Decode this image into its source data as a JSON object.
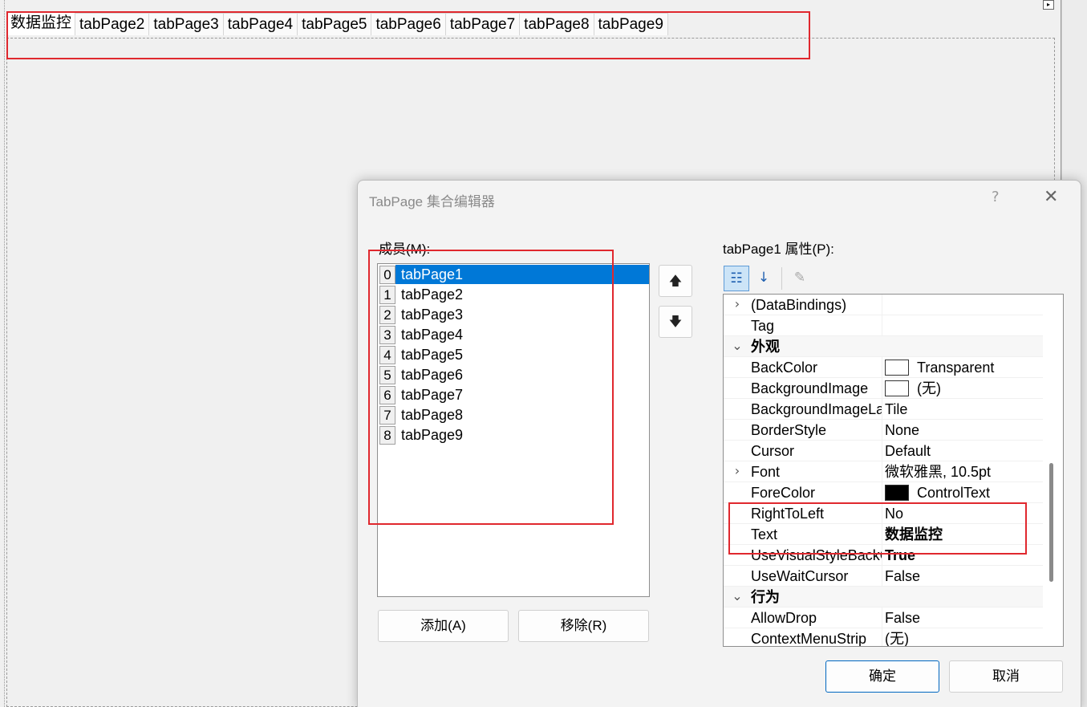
{
  "designer": {
    "tabs": [
      "数据监控",
      "tabPage2",
      "tabPage3",
      "tabPage4",
      "tabPage5",
      "tabPage6",
      "tabPage7",
      "tabPage8",
      "tabPage9"
    ],
    "smart_tag_glyph": "▸"
  },
  "dialog": {
    "title": "TabPage 集合编辑器",
    "help": "?",
    "close": "✕",
    "members_label": "成员(M):",
    "members": [
      {
        "index": "0",
        "name": "tabPage1",
        "selected": true
      },
      {
        "index": "1",
        "name": "tabPage2"
      },
      {
        "index": "2",
        "name": "tabPage3"
      },
      {
        "index": "3",
        "name": "tabPage4"
      },
      {
        "index": "4",
        "name": "tabPage5"
      },
      {
        "index": "5",
        "name": "tabPage6"
      },
      {
        "index": "6",
        "name": "tabPage7"
      },
      {
        "index": "7",
        "name": "tabPage8"
      },
      {
        "index": "8",
        "name": "tabPage9"
      }
    ],
    "move_up": "🡅",
    "move_down": "🡇",
    "add_label": "添加(A)",
    "remove_label": "移除(R)",
    "props_label": "tabPage1 属性(P):",
    "ok_label": "确定",
    "cancel_label": "取消",
    "toolbar": {
      "categorized_icon": "categorized-icon",
      "alphabetical_icon": "alphabetical-icon",
      "property_pages_icon": "wrench-icon"
    },
    "properties": [
      {
        "expander": "›",
        "name": "(DataBindings)",
        "value": ""
      },
      {
        "expander": "",
        "name": "Tag",
        "value": ""
      },
      {
        "expander": "⌄",
        "name": "外观",
        "value": "",
        "category": true
      },
      {
        "expander": "",
        "name": "BackColor",
        "value": "Transparent",
        "swatch": "white"
      },
      {
        "expander": "",
        "name": "BackgroundImage",
        "value": "(无)",
        "swatch": "white"
      },
      {
        "expander": "",
        "name": "BackgroundImageLayout",
        "value": "Tile"
      },
      {
        "expander": "",
        "name": "BorderStyle",
        "value": "None"
      },
      {
        "expander": "",
        "name": "Cursor",
        "value": "Default"
      },
      {
        "expander": "›",
        "name": "Font",
        "value": "微软雅黑, 10.5pt"
      },
      {
        "expander": "",
        "name": "ForeColor",
        "value": "ControlText",
        "swatch": "black"
      },
      {
        "expander": "",
        "name": "RightToLeft",
        "value": "No"
      },
      {
        "expander": "",
        "name": "Text",
        "value": "数据监控",
        "bold": true
      },
      {
        "expander": "",
        "name": "UseVisualStyleBackColor",
        "value": "True",
        "bold": true
      },
      {
        "expander": "",
        "name": "UseWaitCursor",
        "value": "False"
      },
      {
        "expander": "⌄",
        "name": "行为",
        "value": "",
        "category": true
      },
      {
        "expander": "",
        "name": "AllowDrop",
        "value": "False"
      },
      {
        "expander": "",
        "name": "ContextMenuStrip",
        "value": "(无)"
      }
    ]
  },
  "colors": {
    "selection": "#0078d7",
    "highlight_box": "#e0282e"
  }
}
